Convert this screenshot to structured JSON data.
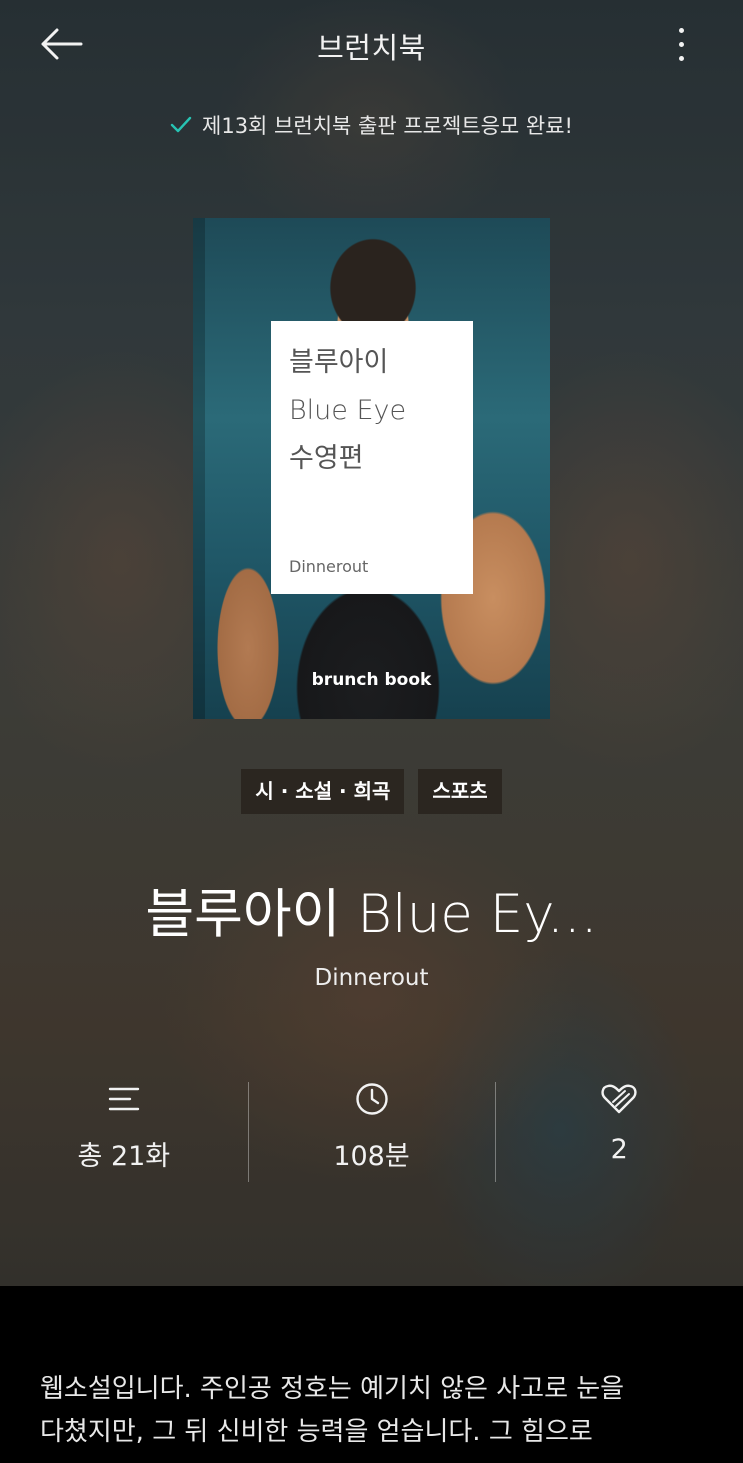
{
  "header": {
    "title": "브런치북"
  },
  "notice": {
    "text": "제13회 브런치북 출판 프로젝트응모 완료!",
    "check_color": "#27c3b3"
  },
  "cover": {
    "title_lines": [
      "블루아이",
      "Blue Eye",
      "수영편"
    ],
    "author": "Dinnerout",
    "brand": "brunch book"
  },
  "tags": [
    "시 · 소설 · 희곡",
    "스포츠"
  ],
  "book": {
    "title": "블루아이 Blue Ey...",
    "author": "Dinnerout"
  },
  "stats": {
    "episodes": "총 21화",
    "duration": "108분",
    "likes": "2"
  },
  "description": {
    "line1": "웹소설입니다. 주인공 정호는 예기치 않은 사고로 눈을",
    "line2": "다쳤지만, 그 뒤 신비한 능력을 얻습니다. 그 힘으로"
  }
}
